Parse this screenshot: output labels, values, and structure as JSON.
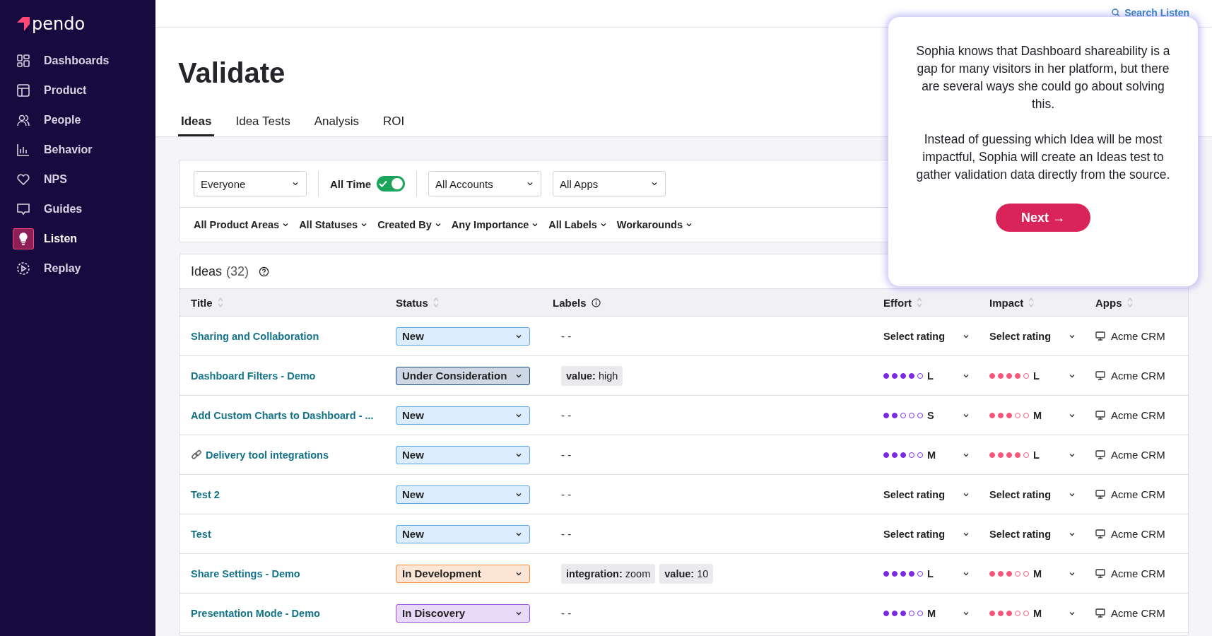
{
  "sidebar": {
    "logo": "pendo",
    "items": [
      {
        "label": "Dashboards",
        "selected": false
      },
      {
        "label": "Product",
        "selected": false
      },
      {
        "label": "People",
        "selected": false
      },
      {
        "label": "Behavior",
        "selected": false
      },
      {
        "label": "NPS",
        "selected": false
      },
      {
        "label": "Guides",
        "selected": false
      },
      {
        "label": "Listen",
        "selected": true
      },
      {
        "label": "Replay",
        "selected": false
      }
    ]
  },
  "top_bar": {
    "search_link": "Search Listen"
  },
  "page_title": "Validate",
  "tabs": [
    {
      "label": "Ideas",
      "selected": true
    },
    {
      "label": "Idea Tests",
      "selected": false
    },
    {
      "label": "Analysis",
      "selected": false
    },
    {
      "label": "ROI",
      "selected": false
    }
  ],
  "filters": {
    "segment": "Everyone",
    "time": {
      "label": "All Time",
      "on": true
    },
    "accounts": "All Accounts",
    "apps": "All Apps",
    "dropdowns": [
      "All Product Areas",
      "All Statuses",
      "Created By",
      "Any Importance",
      "All Labels",
      "Workarounds"
    ]
  },
  "ideas": {
    "title": "Ideas",
    "count": "(32)",
    "columns": [
      {
        "label": "Title",
        "sortable": true,
        "info": false
      },
      {
        "label": "Status",
        "sortable": true,
        "info": false
      },
      {
        "label": "Labels",
        "sortable": false,
        "info": true
      },
      {
        "label": "Effort",
        "sortable": true,
        "info": false
      },
      {
        "label": "Impact",
        "sortable": true,
        "info": false
      },
      {
        "label": "Apps",
        "sortable": true,
        "info": false
      }
    ],
    "rows": [
      {
        "title": "Sharing and Collaboration",
        "linked": false,
        "status": {
          "label": "New",
          "color": "#5aa9f0"
        },
        "labels_text": "- -",
        "effort": {
          "kind": "select",
          "text": "Select rating"
        },
        "impact": {
          "kind": "select",
          "text": "Select rating"
        },
        "app": "Acme CRM"
      },
      {
        "title": "Dashboard Filters - Demo",
        "linked": false,
        "status": {
          "label": "Under Consideration",
          "color": "#1f4f8a"
        },
        "labels": [
          "**value:** high"
        ],
        "effort": {
          "kind": "dots",
          "stars": 4,
          "size": "L"
        },
        "impact": {
          "kind": "dots",
          "stars": 4,
          "size": "L"
        },
        "app": "Acme CRM"
      },
      {
        "title": "Add Custom Charts to Dashboard - ...",
        "linked": false,
        "status": {
          "label": "New",
          "color": "#5aa9f0"
        },
        "labels_text": "- -",
        "effort": {
          "kind": "dots",
          "stars": 2,
          "size": "S"
        },
        "impact": {
          "kind": "dots",
          "stars": 3,
          "size": "M"
        },
        "app": "Acme CRM"
      },
      {
        "title": "Delivery tool integrations",
        "linked": true,
        "status": {
          "label": "New",
          "color": "#5aa9f0"
        },
        "labels_text": "- -",
        "effort": {
          "kind": "dots",
          "stars": 3,
          "size": "M"
        },
        "impact": {
          "kind": "dots",
          "stars": 4,
          "size": "L"
        },
        "app": "Acme CRM"
      },
      {
        "title": "Test 2",
        "linked": false,
        "status": {
          "label": "New",
          "color": "#5aa9f0"
        },
        "labels_text": "- -",
        "effort": {
          "kind": "select",
          "text": "Select rating"
        },
        "impact": {
          "kind": "select",
          "text": "Select rating"
        },
        "app": "Acme CRM"
      },
      {
        "title": "Test",
        "linked": false,
        "status": {
          "label": "New",
          "color": "#5aa9f0"
        },
        "labels_text": "- -",
        "effort": {
          "kind": "select",
          "text": "Select rating"
        },
        "impact": {
          "kind": "select",
          "text": "Select rating"
        },
        "app": "Acme CRM"
      },
      {
        "title": "Share Settings - Demo",
        "linked": false,
        "status": {
          "label": "In Development",
          "color": "#f08a3c"
        },
        "labels": [
          "**integration:** zoom",
          "**value:** 10"
        ],
        "effort": {
          "kind": "dots",
          "stars": 4,
          "size": "L"
        },
        "impact": {
          "kind": "dots",
          "stars": 3,
          "size": "M"
        },
        "app": "Acme CRM"
      },
      {
        "title": "Presentation Mode - Demo",
        "linked": false,
        "status": {
          "label": "In Discovery",
          "color": "#9b51e0"
        },
        "labels_text": "- -",
        "effort": {
          "kind": "dots",
          "stars": 3,
          "size": "M"
        },
        "impact": {
          "kind": "dots",
          "stars": 3,
          "size": "M"
        },
        "app": "Acme CRM"
      }
    ]
  },
  "guide": {
    "paragraphs": [
      "Sophia knows that Dashboard shareability is a gap for many visitors in her platform, but there are several ways she could go about solving this.",
      "Instead of guessing which Idea will be most impactful, Sophia will create an Ideas test to gather validation data directly from the source."
    ],
    "button": "Next →"
  }
}
